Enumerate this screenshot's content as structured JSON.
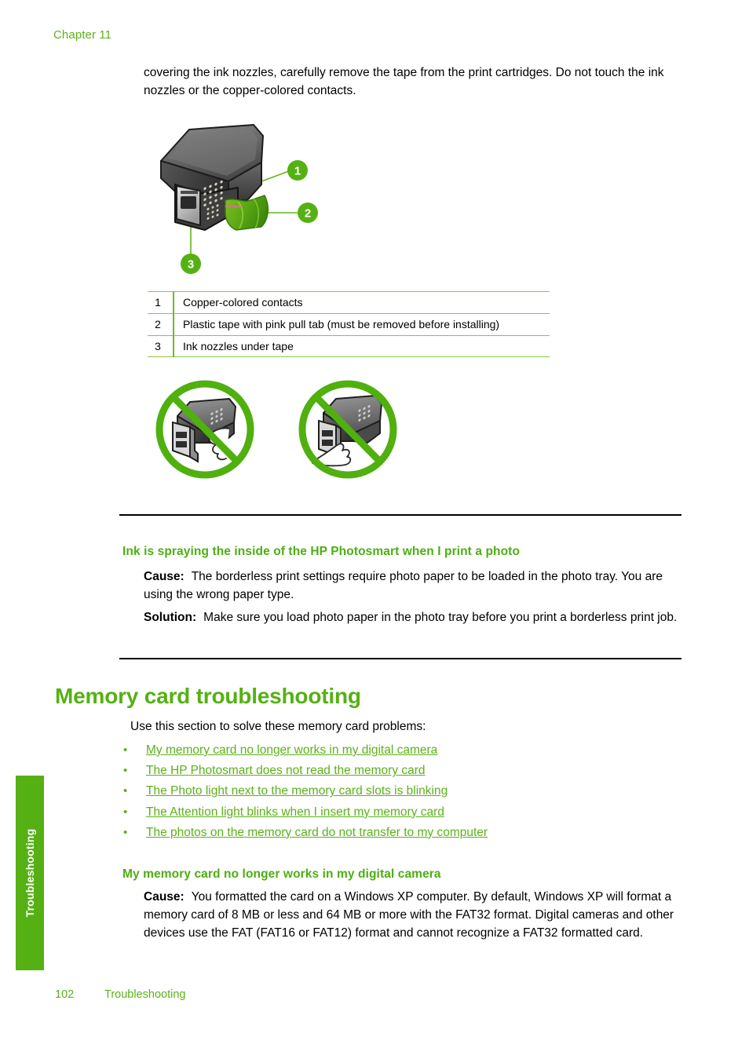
{
  "page": {
    "chapter_header": "Chapter 11",
    "side_tab_label": "Troubleshooting",
    "footer_page_number": "102",
    "footer_section": "Troubleshooting",
    "accent_green": "#55b113",
    "link_green": "#5cb11a",
    "heading_green": "#4caf12",
    "table_border_green": "#8cc63e"
  },
  "intro": {
    "paragraph": "covering the ink nozzles, carefully remove the tape from the print cartridges. Do not touch the ink nozzles or the copper-colored contacts."
  },
  "figure": {
    "name": "print-cartridge-callout-diagram",
    "callouts": [
      "1",
      "2",
      "3"
    ],
    "legend_rows": [
      {
        "num": "1",
        "text": "Copper-colored contacts"
      },
      {
        "num": "2",
        "text": "Plastic tape with pink pull tab (must be removed before installing)"
      },
      {
        "num": "3",
        "text": "Ink nozzles under tape"
      }
    ],
    "prohibition_icons": [
      "do-not-touch-copper-contacts",
      "do-not-touch-ink-nozzles"
    ]
  },
  "ink_spray_issue": {
    "heading": "Ink is spraying the inside of the HP Photosmart when I print a photo",
    "cause_label": "Cause:",
    "cause_text": "The borderless print settings require photo paper to be loaded in the photo tray. You are using the wrong paper type.",
    "solution_label": "Solution:",
    "solution_text": "Make sure you load photo paper in the photo tray before you print a borderless print job."
  },
  "memory_card_section": {
    "title": "Memory card troubleshooting",
    "intro": "Use this section to solve these memory card problems:",
    "bullet": "•",
    "links": [
      "My memory card no longer works in my digital camera",
      "The HP Photosmart does not read the memory card",
      "The Photo light next to the memory card slots is blinking",
      "The Attention light blinks when I insert my memory card",
      "The photos on the memory card do not transfer to my computer"
    ]
  },
  "memory_card_issue": {
    "heading": "My memory card no longer works in my digital camera",
    "cause_label": "Cause:",
    "cause_text": "You formatted the card on a Windows XP computer. By default, Windows XP will format a memory card of 8 MB or less and 64 MB or more with the FAT32 format. Digital cameras and other devices use the FAT (FAT16 or FAT12) format and cannot recognize a FAT32 formatted card."
  }
}
